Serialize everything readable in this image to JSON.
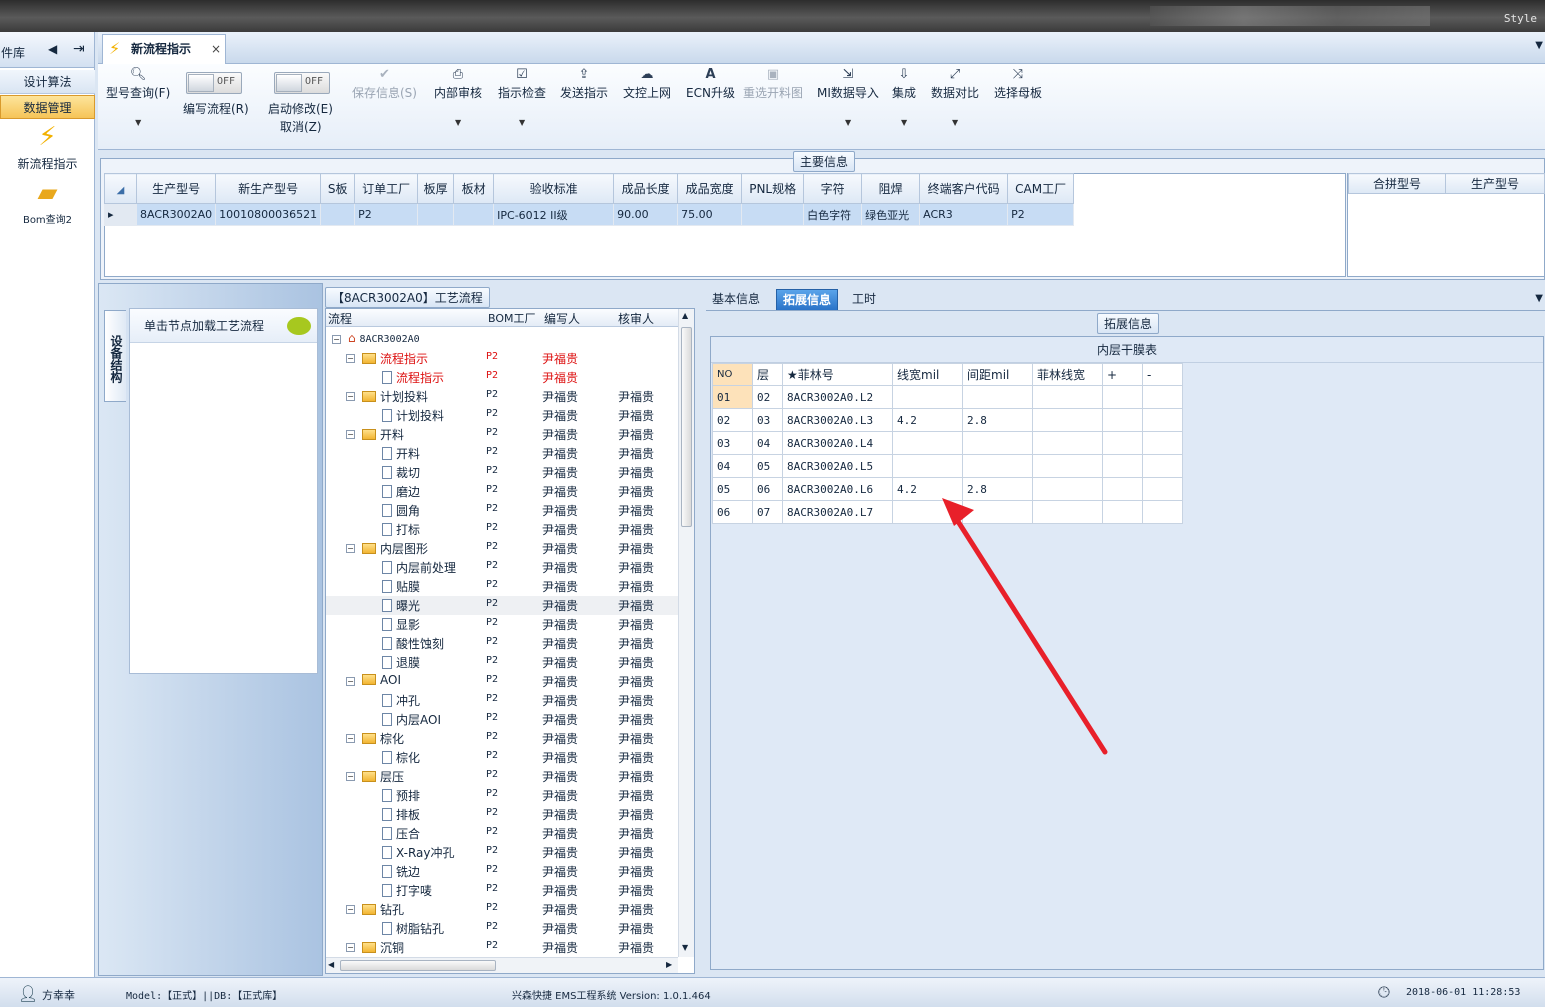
{
  "window": {
    "style_label": "Style"
  },
  "left_nav": {
    "header": "件库",
    "buttons": [
      "设计算法",
      "数据管理"
    ],
    "items": [
      {
        "label": "新流程指示",
        "icon": "lightning-icon"
      },
      {
        "label": "Bom查询2",
        "icon": "folder-open-icon"
      }
    ]
  },
  "doc_tab": {
    "label": "新流程指示",
    "close": "×"
  },
  "toolbar": {
    "query": "型号查询(F)",
    "write_flow": "编写流程(R)",
    "start_edit": "启动修改(E)",
    "cancel": "取消(Z)",
    "toggle_off": "OFF",
    "save": "保存信息(S)",
    "internal_review": "内部审核",
    "check": "指示检查",
    "send": "发送指示",
    "doc_upload": "文控上网",
    "ecn": "ECN升级",
    "reselect": "重选开料图",
    "mi_import": "MI数据导入",
    "integrate": "集成",
    "compare": "数据对比",
    "mother_board": "选择母板"
  },
  "main_info": {
    "title": "主要信息",
    "columns": [
      "生产型号",
      "新生产型号",
      "S板",
      "订单工厂",
      "板厚",
      "板材",
      "验收标准",
      "成品长度",
      "成品宽度",
      "PNL规格",
      "字符",
      "阻焊",
      "终端客户代码",
      "CAM工厂"
    ],
    "row": [
      "8ACR3002A0",
      "10010800036521",
      "",
      "P2",
      "",
      "",
      "IPC-6012 II级",
      "90.00",
      "75.00",
      "",
      "白色字符",
      "绿色亚光",
      "ACR3",
      "P2"
    ],
    "side_columns": [
      "合拼型号",
      "生产型号"
    ]
  },
  "process": {
    "title": "【8ACR3002A0】工艺流程",
    "side_tab": "设备结构",
    "load_hint": "单击节点加载工艺流程",
    "columns": [
      "流程",
      "BOM工厂",
      "编写人",
      "核审人"
    ],
    "root": "8ACR3002A0",
    "rows": [
      {
        "name": "流程指示",
        "level": 1,
        "factory": "P2",
        "writer": "尹福贵",
        "reviewer": "",
        "red": true
      },
      {
        "name": "流程指示",
        "level": 2,
        "factory": "P2",
        "writer": "尹福贵",
        "reviewer": "",
        "red": true
      },
      {
        "name": "计划投料",
        "level": 1,
        "factory": "P2",
        "writer": "尹福贵",
        "reviewer": "尹福贵"
      },
      {
        "name": "计划投料",
        "level": 2,
        "factory": "P2",
        "writer": "尹福贵",
        "reviewer": "尹福贵"
      },
      {
        "name": "开料",
        "level": 1,
        "factory": "P2",
        "writer": "尹福贵",
        "reviewer": "尹福贵"
      },
      {
        "name": "开料",
        "level": 2,
        "factory": "P2",
        "writer": "尹福贵",
        "reviewer": "尹福贵"
      },
      {
        "name": "裁切",
        "level": 2,
        "factory": "P2",
        "writer": "尹福贵",
        "reviewer": "尹福贵"
      },
      {
        "name": "磨边",
        "level": 2,
        "factory": "P2",
        "writer": "尹福贵",
        "reviewer": "尹福贵"
      },
      {
        "name": "圆角",
        "level": 2,
        "factory": "P2",
        "writer": "尹福贵",
        "reviewer": "尹福贵"
      },
      {
        "name": "打标",
        "level": 2,
        "factory": "P2",
        "writer": "尹福贵",
        "reviewer": "尹福贵"
      },
      {
        "name": "内层图形",
        "level": 1,
        "factory": "P2",
        "writer": "尹福贵",
        "reviewer": "尹福贵"
      },
      {
        "name": "内层前处理",
        "level": 2,
        "factory": "P2",
        "writer": "尹福贵",
        "reviewer": "尹福贵"
      },
      {
        "name": "贴膜",
        "level": 2,
        "factory": "P2",
        "writer": "尹福贵",
        "reviewer": "尹福贵"
      },
      {
        "name": "曝光",
        "level": 2,
        "factory": "P2",
        "writer": "尹福贵",
        "reviewer": "尹福贵",
        "hl": true
      },
      {
        "name": "显影",
        "level": 2,
        "factory": "P2",
        "writer": "尹福贵",
        "reviewer": "尹福贵"
      },
      {
        "name": "酸性蚀刻",
        "level": 2,
        "factory": "P2",
        "writer": "尹福贵",
        "reviewer": "尹福贵"
      },
      {
        "name": "退膜",
        "level": 2,
        "factory": "P2",
        "writer": "尹福贵",
        "reviewer": "尹福贵"
      },
      {
        "name": "AOI",
        "level": 1,
        "factory": "P2",
        "writer": "尹福贵",
        "reviewer": "尹福贵"
      },
      {
        "name": "冲孔",
        "level": 2,
        "factory": "P2",
        "writer": "尹福贵",
        "reviewer": "尹福贵"
      },
      {
        "name": "内层AOI",
        "level": 2,
        "factory": "P2",
        "writer": "尹福贵",
        "reviewer": "尹福贵"
      },
      {
        "name": "棕化",
        "level": 1,
        "factory": "P2",
        "writer": "尹福贵",
        "reviewer": "尹福贵"
      },
      {
        "name": "棕化",
        "level": 2,
        "factory": "P2",
        "writer": "尹福贵",
        "reviewer": "尹福贵"
      },
      {
        "name": "层压",
        "level": 1,
        "factory": "P2",
        "writer": "尹福贵",
        "reviewer": "尹福贵"
      },
      {
        "name": "预排",
        "level": 2,
        "factory": "P2",
        "writer": "尹福贵",
        "reviewer": "尹福贵"
      },
      {
        "name": "排板",
        "level": 2,
        "factory": "P2",
        "writer": "尹福贵",
        "reviewer": "尹福贵"
      },
      {
        "name": "压合",
        "level": 2,
        "factory": "P2",
        "writer": "尹福贵",
        "reviewer": "尹福贵"
      },
      {
        "name": "X-Ray冲孔",
        "level": 2,
        "factory": "P2",
        "writer": "尹福贵",
        "reviewer": "尹福贵"
      },
      {
        "name": "铣边",
        "level": 2,
        "factory": "P2",
        "writer": "尹福贵",
        "reviewer": "尹福贵"
      },
      {
        "name": "打字唛",
        "level": 2,
        "factory": "P2",
        "writer": "尹福贵",
        "reviewer": "尹福贵"
      },
      {
        "name": "钻孔",
        "level": 1,
        "factory": "P2",
        "writer": "尹福贵",
        "reviewer": "尹福贵"
      },
      {
        "name": "树脂钻孔",
        "level": 2,
        "factory": "P2",
        "writer": "尹福贵",
        "reviewer": "尹福贵"
      },
      {
        "name": "沉铜",
        "level": 1,
        "factory": "P2",
        "writer": "尹福贵",
        "reviewer": "尹福贵"
      }
    ]
  },
  "right_tabs": [
    "基本信息",
    "拓展信息",
    "工时"
  ],
  "extended": {
    "group_title": "拓展信息",
    "table_title": "内层干膜表",
    "columns": [
      "NO",
      "层",
      "★菲林号",
      "线宽mil",
      "间距mil",
      "菲林线宽",
      "+",
      "-"
    ],
    "rows": [
      [
        "01",
        "02",
        "8ACR3002A0.L2",
        "",
        "",
        "",
        "",
        ""
      ],
      [
        "02",
        "03",
        "8ACR3002A0.L3",
        "4.2",
        "2.8",
        "",
        "",
        ""
      ],
      [
        "03",
        "04",
        "8ACR3002A0.L4",
        "",
        "",
        "",
        "",
        ""
      ],
      [
        "04",
        "05",
        "8ACR3002A0.L5",
        "",
        "",
        "",
        "",
        ""
      ],
      [
        "05",
        "06",
        "8ACR3002A0.L6",
        "4.2",
        "2.8",
        "",
        "",
        ""
      ],
      [
        "06",
        "07",
        "8ACR3002A0.L7",
        "",
        "",
        "",
        "",
        ""
      ]
    ]
  },
  "status": {
    "user": "方幸幸",
    "model": "Model:【正式】||DB:【正式库】",
    "system": "兴森快捷 EMS工程系统 Version: 1.0.1.464",
    "datetime": "2018-06-01 11:28:53"
  },
  "colors": {
    "accent_red": "#e8202a",
    "selected_tab": "#2a73c8",
    "active_nav": "#f6c457"
  }
}
